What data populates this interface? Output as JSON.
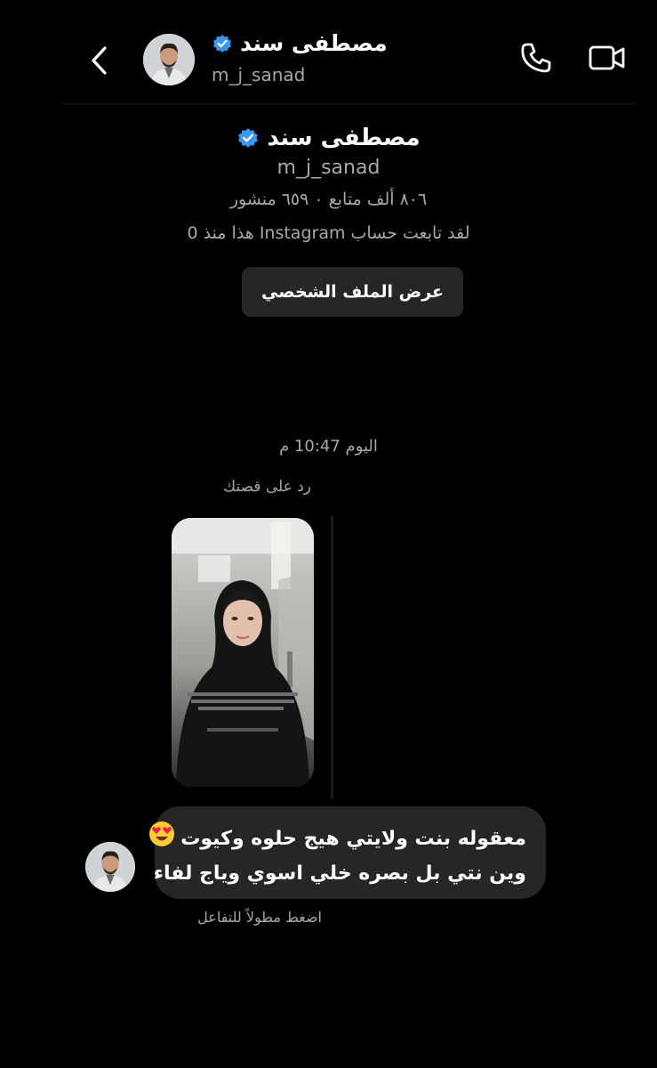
{
  "header": {
    "name": "مصطفى سند",
    "username": "m_j_sanad"
  },
  "profile": {
    "name": "مصطفى سند",
    "username": "m_j_sanad",
    "stats": "٨٠٦ ألف متابع ٠ ٦٥٩ منشور",
    "follow_note": "لقد تابعت حساب Instagram هذا منذ 0",
    "view_profile_label": "عرض الملف الشخصي"
  },
  "conversation": {
    "timestamp": "اليوم 10:47 م",
    "reply_label": "رد على قصتك",
    "message_line1": "معقوله بنت ولايتي هيج حلوه وكيوت",
    "message_line2": "وين نتي بل بصره خلي اسوي وياج لفاء",
    "message_emoji": "heart-eyes-emoji",
    "hint": "اضغط مطولاً للتفاعل"
  },
  "colors": {
    "background": "#000000",
    "bubble": "#262626",
    "secondary_text": "#a8a8a8",
    "verified": "#3897f0"
  }
}
